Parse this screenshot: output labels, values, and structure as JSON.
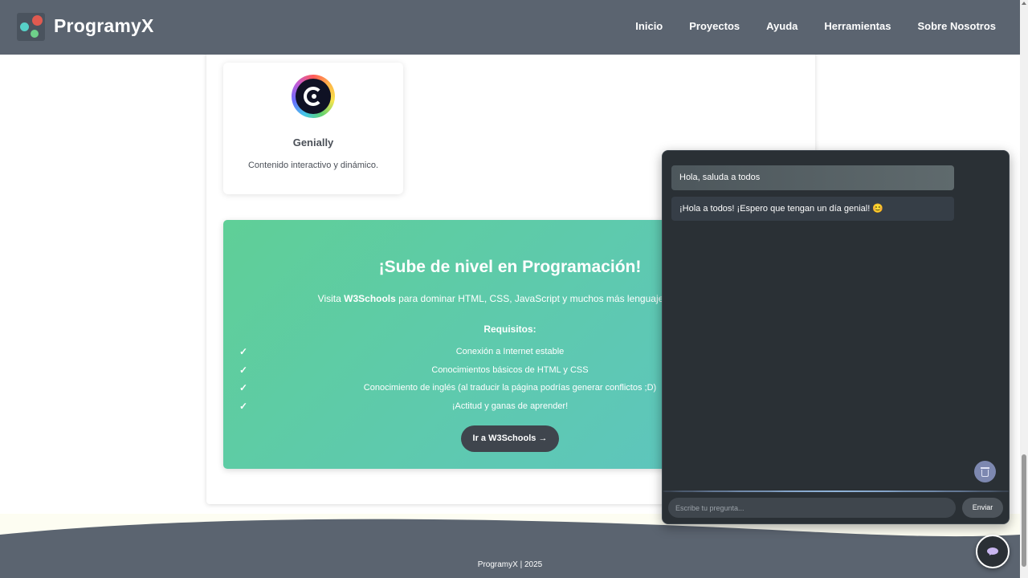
{
  "header": {
    "brand": "ProgramyX",
    "nav": [
      "Inicio",
      "Proyectos",
      "Ayuda",
      "Herramientas",
      "Sobre Nosotros"
    ]
  },
  "tool_card": {
    "name": "Genially",
    "description": "Contenido interactivo y dinámico.",
    "icon": "genially-logo-icon"
  },
  "promo": {
    "title": "¡Sube de nivel en Programación!",
    "text_prefix": "Visita ",
    "text_brand": "W3Schools",
    "text_suffix": " para dominar HTML, CSS, JavaScript y muchos más lenguajes con eje",
    "requirements_title": "Requisitos:",
    "check_symbol": "✓",
    "requirements": [
      "Conexión a Internet estable",
      "Conocimientos básicos de HTML y CSS",
      "Conocimiento de inglés (al traducir la página podrías generar conflictos ;D)",
      "¡Actitud y ganas de aprender!"
    ],
    "button_label": "Ir a W3Schools →"
  },
  "chat": {
    "messages": [
      {
        "role": "user",
        "text": "Hola, saluda a todos"
      },
      {
        "role": "bot",
        "text": "¡Hola a todos! ¡Espero que tengan un día genial! 😊"
      }
    ],
    "input_placeholder": "Escribe tu pregunta...",
    "input_value": "",
    "send_label": "Enviar"
  },
  "footer": {
    "text": "ProgramyX | 2025"
  },
  "colors": {
    "header_bg": "#5b6470",
    "promo_gradient_start": "#5fcf97",
    "promo_gradient_end": "#5dc4c3",
    "chat_bg": "#2a3035",
    "footer_wave": "#5b6470"
  }
}
